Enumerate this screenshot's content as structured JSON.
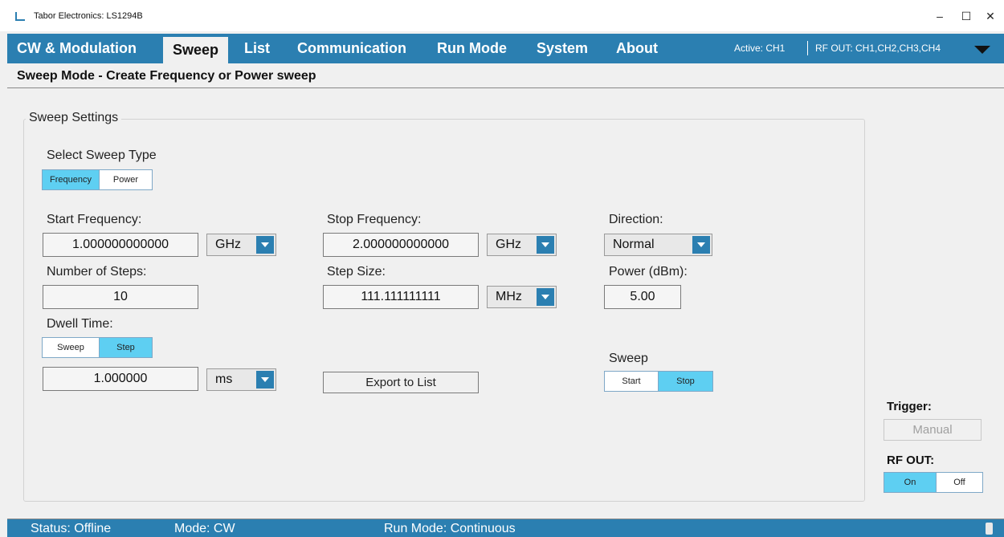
{
  "window": {
    "title": "Tabor Electronics: LS1294B",
    "min_glyph": "–",
    "max_glyph": "☐",
    "close_glyph": "✕"
  },
  "nav": {
    "tabs": [
      {
        "label": "CW & Modulation"
      },
      {
        "label": "Sweep"
      },
      {
        "label": "List"
      },
      {
        "label": "Communication"
      },
      {
        "label": "Run Mode"
      },
      {
        "label": "System"
      },
      {
        "label": "About"
      }
    ],
    "active_tab": "Sweep",
    "active_info": "Active:  CH1",
    "rfout_info": "RF OUT:  CH1,CH2,CH3,CH4"
  },
  "subheader": "Sweep Mode - Create Frequency or Power sweep",
  "sweep_settings": {
    "group_label": "Sweep Settings",
    "sweep_type": {
      "label": "Select Sweep Type",
      "options": [
        "Frequency",
        "Power"
      ],
      "selected": "Frequency"
    },
    "start_frequency": {
      "label": "Start Frequency:",
      "value": "1.000000000000",
      "unit": "GHz"
    },
    "stop_frequency": {
      "label": "Stop Frequency:",
      "value": "2.000000000000",
      "unit": "GHz"
    },
    "direction": {
      "label": "Direction:",
      "value": "Normal"
    },
    "num_steps": {
      "label": "Number of Steps:",
      "value": "10"
    },
    "step_size": {
      "label": "Step Size:",
      "value": "111.111111111",
      "unit": "MHz"
    },
    "power": {
      "label": "Power (dBm):",
      "value": "5.00"
    },
    "dwell_time": {
      "label": "Dwell Time:",
      "options": [
        "Sweep",
        "Step"
      ],
      "selected": "Step",
      "value": "1.000000",
      "unit": "ms"
    },
    "export_button": "Export to List",
    "sweep_control": {
      "label": "Sweep",
      "options": [
        "Start",
        "Stop"
      ],
      "selected": "Stop"
    }
  },
  "trigger": {
    "label": "Trigger:",
    "button": "Manual"
  },
  "rf_out": {
    "label": "RF OUT:",
    "options": [
      "On",
      "Off"
    ],
    "selected": "On"
  },
  "status": {
    "status": "Status: Offline",
    "mode": "Mode: CW",
    "run_mode": "Run Mode: Continuous"
  },
  "colors": {
    "accent": "#2b7fb1",
    "selected_segment": "#5ecff2"
  }
}
